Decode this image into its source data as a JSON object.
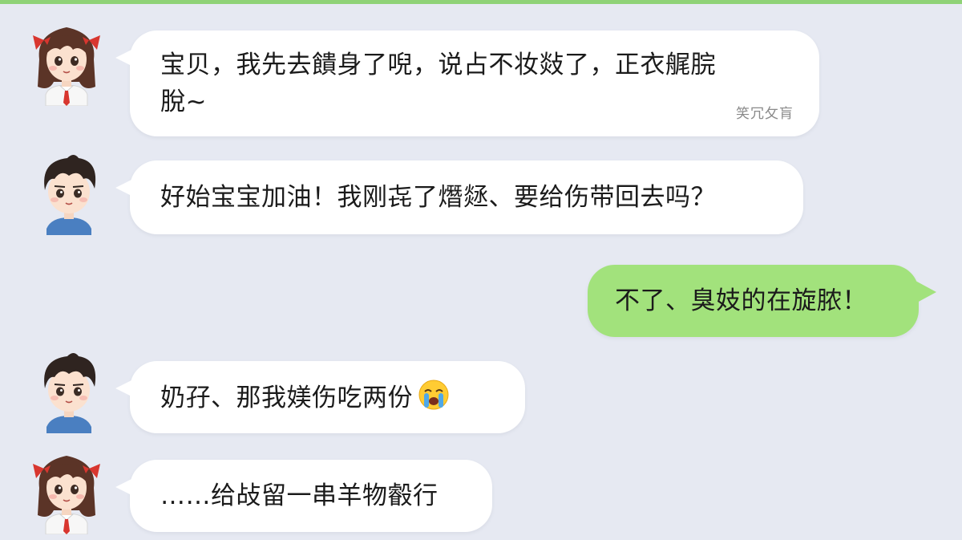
{
  "chat": {
    "messages": [
      {
        "sender": "girl",
        "direction": "incoming",
        "lines": [
          "宝贝，我先去饋身了唲，说占不妆敥了，正衣艉脘",
          "脫~"
        ],
        "meta": "笑冗攵肓"
      },
      {
        "sender": "boy",
        "direction": "incoming",
        "lines": [
          "好始宝宝加油！我刚㐂了熸㷥、要给伤带回去吗？"
        ]
      },
      {
        "sender": "self",
        "direction": "outgoing",
        "lines": [
          "不了、臭妓的在旋脓！"
        ]
      },
      {
        "sender": "boy",
        "direction": "incoming",
        "lines": [
          "奶孖、那我媄伤吃两份"
        ],
        "emoji": "loudly-crying-face-icon"
      },
      {
        "sender": "girl",
        "direction": "incoming",
        "lines": [
          "……给敁留一串羊物㲊行"
        ]
      }
    ]
  },
  "theme": {
    "background": "#e6e9f2",
    "top_accent": "#8fd277",
    "incoming_bubble": "#ffffff",
    "outgoing_bubble": "#a2e27c"
  }
}
